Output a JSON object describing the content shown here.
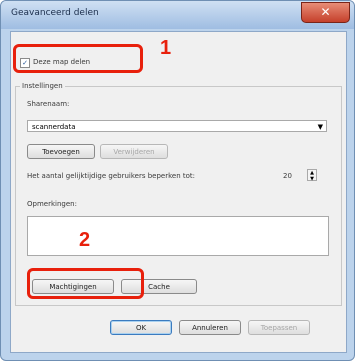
{
  "window": {
    "title": "Geavanceerd delen",
    "close_label": "✕"
  },
  "share": {
    "checkbox_label": "Deze map delen",
    "checked_mark": "✓"
  },
  "settings": {
    "group_label": "Instellingen",
    "share_name_label": "Sharenaam:",
    "share_name_value": "scannerdata",
    "add_label": "Toevoegen",
    "remove_label": "Verwijderen",
    "limit_label": "Het aantal gelijktijdige gebruikers beperken tot:",
    "limit_value": "20",
    "comments_label": "Opmerkingen:"
  },
  "buttons": {
    "permissions": "Machtigingen",
    "caching": "Cache",
    "ok": "OK",
    "cancel": "Annuleren",
    "apply": "Toepassen"
  },
  "annotations": {
    "marker1": "1",
    "marker2": "2",
    "color": "#e8200c"
  }
}
